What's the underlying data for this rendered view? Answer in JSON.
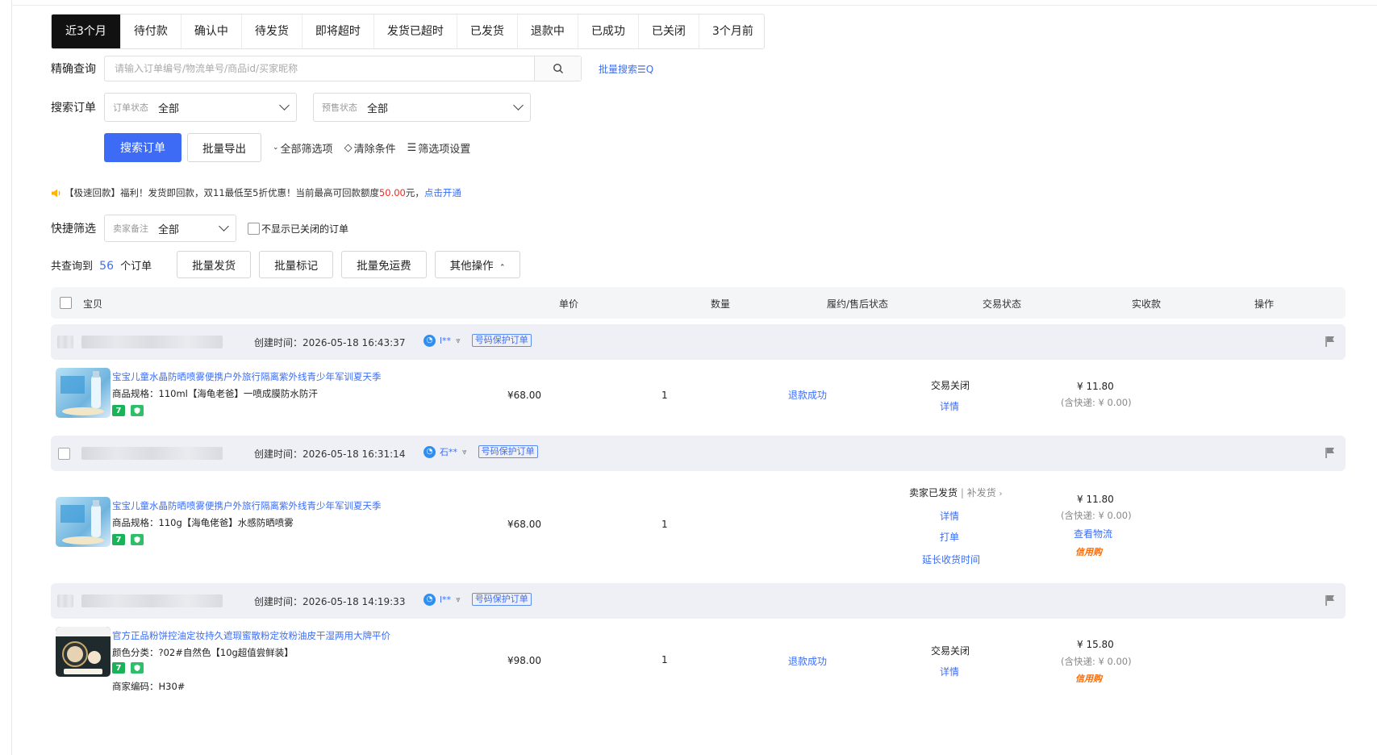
{
  "tabs": [
    {
      "label": "近3个月",
      "active": true
    },
    {
      "label": "待付款"
    },
    {
      "label": "确认中"
    },
    {
      "label": "待发货"
    },
    {
      "label": "即将超时"
    },
    {
      "label": "发货已超时"
    },
    {
      "label": "已发货"
    },
    {
      "label": "退款中"
    },
    {
      "label": "已成功"
    },
    {
      "label": "已关闭"
    },
    {
      "label": "3个月前"
    }
  ],
  "precise": {
    "label": "精确查询",
    "placeholder": "请输入订单编号/物流单号/商品id/买家昵称",
    "batch_search": "批量搜索☰Q"
  },
  "search_orders": {
    "label": "搜索订单",
    "order_status_prefix": "订单状态",
    "order_status_value": "全部",
    "presale_prefix": "预售状态",
    "presale_value": "全部"
  },
  "actions": {
    "search_button": "搜索订单",
    "export_button": "批量导出",
    "all_filters": "全部筛选项",
    "clear": "清除条件",
    "filter_settings": "筛选项设置"
  },
  "promo": {
    "prefix": "【极速回款】福利！发货即回款，双11最低至5折优惠！当前最高可回款额度",
    "amount": "50.00",
    "suffix": "元，",
    "link": "点击开通"
  },
  "quick_filter": {
    "label": "快捷筛选",
    "note_prefix": "卖家备注",
    "note_value": "全部",
    "hide_closed": "不显示已关闭的订单"
  },
  "summary": {
    "prefix": "共查询到",
    "count": "56",
    "suffix": "个订单",
    "batch_ship": "批量发货",
    "batch_mark": "批量标记",
    "batch_free_shipping": "批量免运费",
    "other_ops": "其他操作"
  },
  "table_headers": {
    "item": "宝贝",
    "price": "单价",
    "qty": "数量",
    "fulfillment": "履约/售后状态",
    "trade_status": "交易状态",
    "received": "实收款",
    "ops": "操作"
  },
  "orders": [
    {
      "created": "创建时间：2026-05-18 16:43:37",
      "buyer": "l**",
      "tag": "号码保护订单",
      "title": "宝宝儿童水晶防晒喷雾便携户外旅行隔离紫外线青少年军训夏天季",
      "spec": "商品规格：110ml【海龟老爸】一喷成膜防水防汗",
      "price": "¥68.00",
      "qty": "1",
      "fulfillment": "退款成功",
      "status": "交易关闭",
      "detail": "详情",
      "received": "¥ 11.80",
      "shipping": "(含快递: ¥ 0.00)"
    },
    {
      "created": "创建时间：2026-05-18 16:31:14",
      "buyer": "石**",
      "tag": "号码保护订单",
      "title": "宝宝儿童水晶防晒喷雾便携户外旅行隔离紫外线青少年军训夏天季",
      "spec": "商品规格：110g【海龟佬爸】水感防晒喷雾",
      "price": "¥68.00",
      "qty": "1",
      "status": "卖家已发货",
      "resend": "补发货",
      "detail": "详情",
      "print": "打单",
      "extend": "延长收货时间",
      "received": "¥ 11.80",
      "shipping": "(含快递: ¥ 0.00)",
      "logistics": "查看物流",
      "credit": "信用购"
    },
    {
      "created": "创建时间：2026-05-18 14:19:33",
      "buyer": "l**",
      "tag": "号码保护订单",
      "title": "官方正品粉饼控油定妆持久遮瑕蜜散粉定妆粉油皮干湿两用大牌平价",
      "spec": "颜色分类：?02#自然色【10g超值尝鲜装】",
      "merchant_code": "商家编码：H30#",
      "price": "¥98.00",
      "qty": "1",
      "fulfillment": "退款成功",
      "status": "交易关闭",
      "detail": "详情",
      "received": "¥ 15.80",
      "shipping": "(含快递: ¥ 0.00)",
      "credit": "信用购"
    }
  ],
  "colors": {
    "accent": "#3e6bf6",
    "link": "#3d6ef5",
    "red": "#f0281e",
    "orange": "#ff6a00",
    "tab_active_bg": "#111111"
  }
}
